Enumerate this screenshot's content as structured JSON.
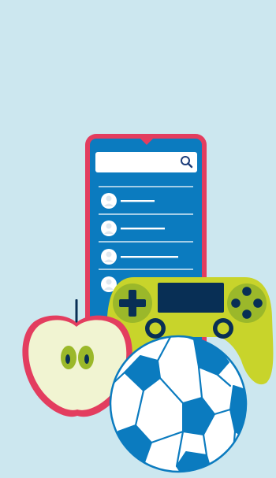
{
  "illustration": {
    "icons": [
      "smartphone-icon",
      "search-icon",
      "avatar-icon",
      "game-controller-icon",
      "apple-icon",
      "soccer-ball-icon"
    ],
    "colors": {
      "background": "#cce7ef",
      "phone_frame": "#e33d5f",
      "phone_screen": "#0b7bbf",
      "search_bar": "#ffffff",
      "list_line": "#ffffff",
      "controller_body": "#c8d42b",
      "controller_screen": "#082f55",
      "controller_buttons": "#082f55",
      "apple_skin": "#e33d5f",
      "apple_flesh": "#f1f4d2",
      "apple_seeds": "#9bb82a",
      "ball_white": "#ffffff",
      "ball_panels": "#0b7bbf"
    }
  }
}
